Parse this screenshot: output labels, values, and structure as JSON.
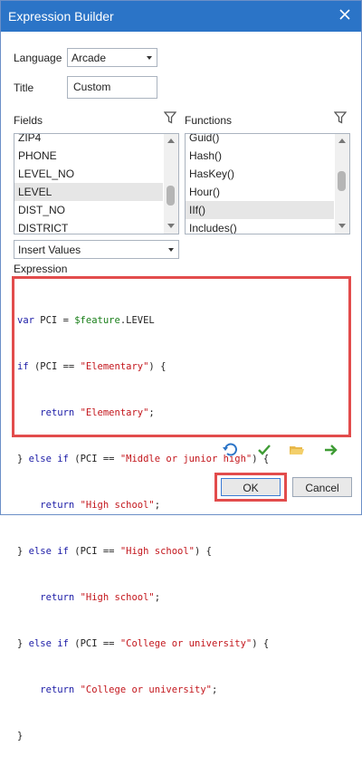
{
  "window": {
    "title": "Expression Builder"
  },
  "form": {
    "language_label": "Language",
    "language_value": "Arcade",
    "title_label": "Title",
    "title_value": "Custom"
  },
  "fields": {
    "label": "Fields",
    "items": [
      "ZIP4",
      "PHONE",
      "LEVEL_NO",
      "LEVEL",
      "DIST_NO",
      "DISTRICT"
    ],
    "selected": "LEVEL"
  },
  "functions": {
    "label": "Functions",
    "items": [
      "Guid()",
      "Hash()",
      "HasKey()",
      "Hour()",
      "IIf()",
      "Includes()"
    ],
    "selected": "IIf()"
  },
  "insert_values": {
    "value": "Insert Values"
  },
  "expression": {
    "label": "Expression",
    "lines": [
      "var PCI = $feature.LEVEL",
      "if (PCI == \"Elementary\") {",
      "    return \"Elementary\";",
      "} else if (PCI == \"Middle or junior high\") {",
      "    return \"High school\";",
      "} else if (PCI == \"High school\") {",
      "    return \"High school\";",
      "} else if (PCI == \"College or university\") {",
      "    return \"College or university\";",
      "}"
    ]
  },
  "buttons": {
    "ok": "OK",
    "cancel": "Cancel"
  },
  "colors": {
    "titlebar": "#2b74c7",
    "highlight_border": "#e24c4c",
    "keyword": "#1a1aa6",
    "string": "#c3161c",
    "variable": "#1a7f1a"
  },
  "icons": [
    "close-icon",
    "filter-icon",
    "undo-icon",
    "check-icon",
    "folder-open-icon",
    "arrow-right-icon"
  ]
}
